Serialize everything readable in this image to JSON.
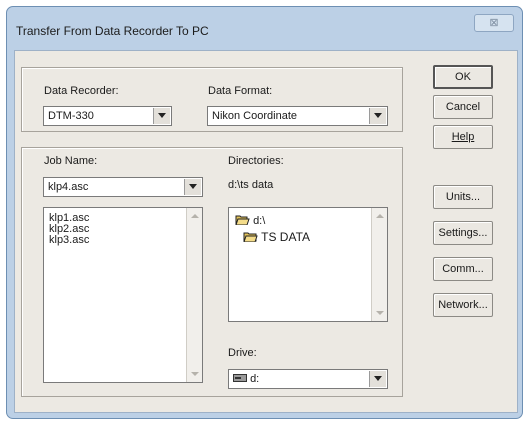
{
  "window": {
    "title": "Transfer From Data Recorder To PC",
    "close_glyph": "⊠"
  },
  "data_recorder": {
    "label": "Data Recorder:",
    "value": "DTM-330"
  },
  "data_format": {
    "label": "Data Format:",
    "value": "Nikon Coordinate"
  },
  "job": {
    "label": "Job Name:",
    "value": "klp4.asc",
    "files": [
      "klp1.asc",
      "klp2.asc",
      "klp3.asc"
    ]
  },
  "directories": {
    "label": "Directories:",
    "current_path": "d:\\ts data",
    "tree": [
      {
        "name": "d:\\",
        "icon": "open-folder-icon"
      },
      {
        "name": "TS DATA",
        "icon": "folder-icon"
      }
    ]
  },
  "drive": {
    "label": "Drive:",
    "value": "d:",
    "icon": "drive-icon"
  },
  "buttons": {
    "ok": "OK",
    "cancel": "Cancel",
    "help": "Help",
    "units": "Units...",
    "settings": "Settings...",
    "comm": "Comm...",
    "network": "Network..."
  },
  "colors": {
    "title_bar": "#bcd0e6",
    "dialog_face": "#ece9e3",
    "folder": "#e3c35a"
  }
}
